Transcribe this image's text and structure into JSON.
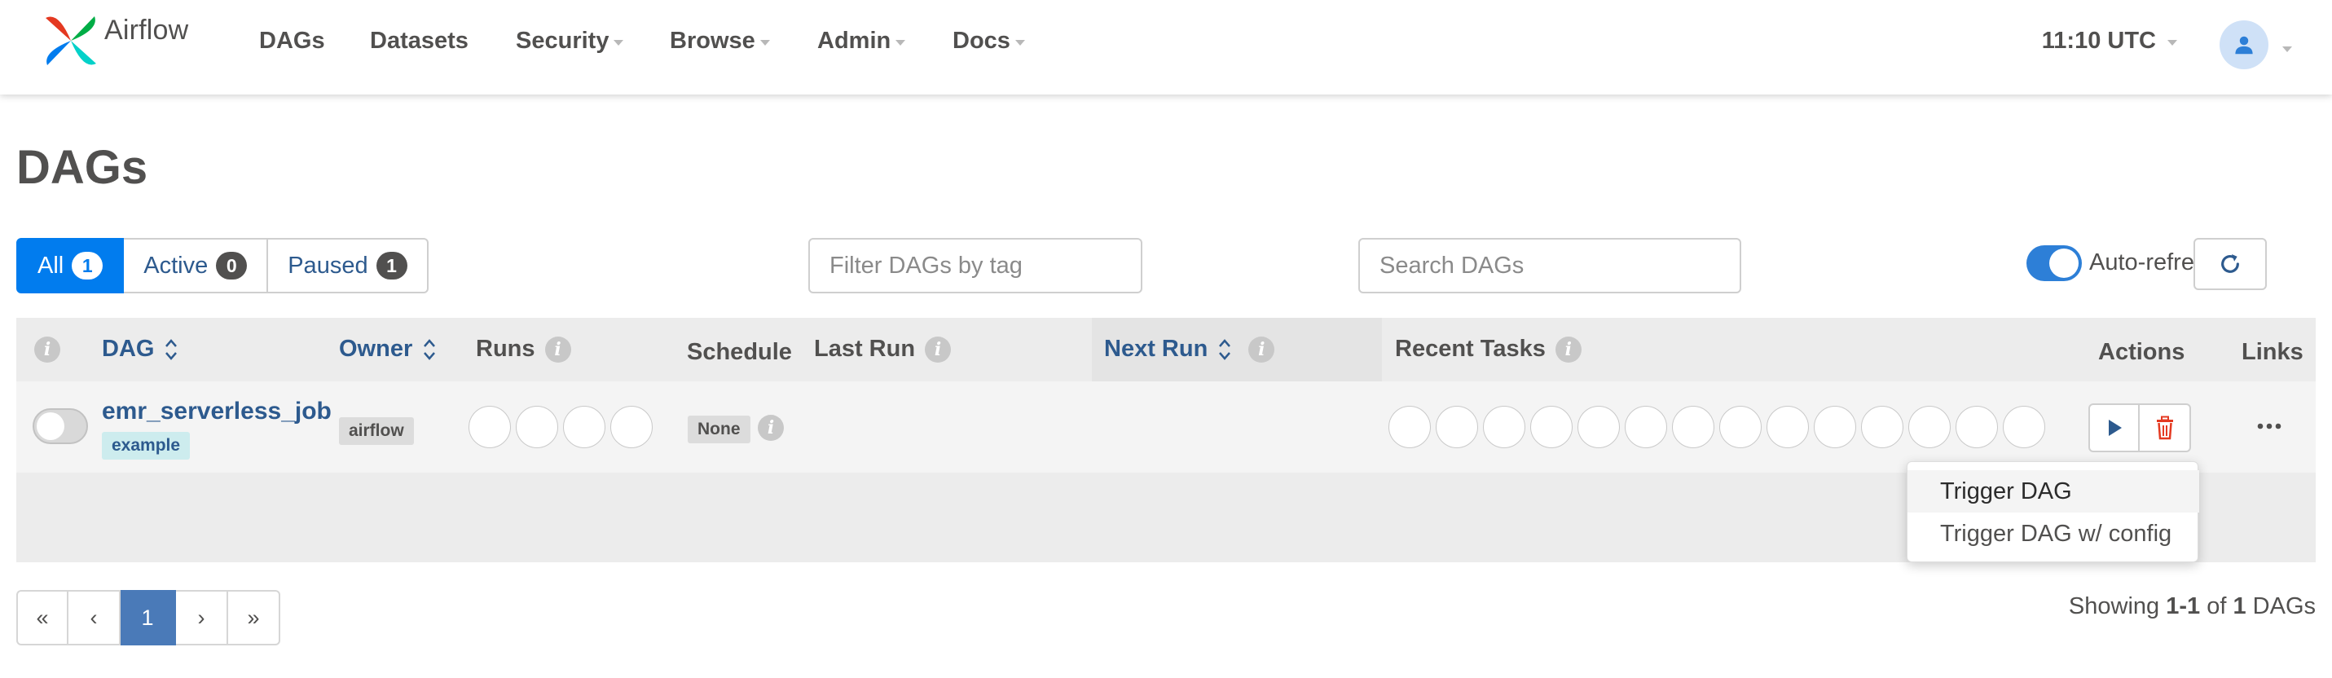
{
  "brand": {
    "name": "Airflow"
  },
  "nav": {
    "items": [
      {
        "label": "DAGs",
        "dropdown": false
      },
      {
        "label": "Datasets",
        "dropdown": false
      },
      {
        "label": "Security",
        "dropdown": true
      },
      {
        "label": "Browse",
        "dropdown": true
      },
      {
        "label": "Admin",
        "dropdown": true
      },
      {
        "label": "Docs",
        "dropdown": true
      }
    ],
    "time": "11:10 UTC",
    "user_icon": "person-icon"
  },
  "page": {
    "title": "DAGs"
  },
  "filters": {
    "status_tabs": [
      {
        "label": "All",
        "count": "1",
        "active": true
      },
      {
        "label": "Active",
        "count": "0",
        "active": false
      },
      {
        "label": "Paused",
        "count": "1",
        "active": false
      }
    ],
    "tag_placeholder": "Filter DAGs by tag",
    "search_placeholder": "Search DAGs",
    "auto_refresh_label": "Auto-refresh",
    "auto_refresh_on": true
  },
  "table": {
    "headers": {
      "dag": "DAG",
      "owner": "Owner",
      "runs": "Runs",
      "schedule": "Schedule",
      "last_run": "Last Run",
      "next_run": "Next Run",
      "recent_tasks": "Recent Tasks",
      "actions": "Actions",
      "links": "Links"
    },
    "rows": [
      {
        "dag_id": "emr_serverless_job",
        "tag": "example",
        "owner": "airflow",
        "schedule": "None",
        "paused": true,
        "run_circles": 4,
        "task_circles": 14
      }
    ]
  },
  "trigger_menu": {
    "items": [
      "Trigger DAG",
      "Trigger DAG w/ config"
    ]
  },
  "pagination": {
    "first": "«",
    "prev": "‹",
    "current": "1",
    "next": "›",
    "last": "»",
    "showing_prefix": "Showing",
    "showing_range": "1-1",
    "showing_of": "of",
    "showing_total": "1",
    "showing_suffix": "DAGs"
  },
  "colors": {
    "primary": "#017cee",
    "link": "#2d5a8e",
    "delete": "#e43921",
    "tag_bg": "#cdecee"
  }
}
